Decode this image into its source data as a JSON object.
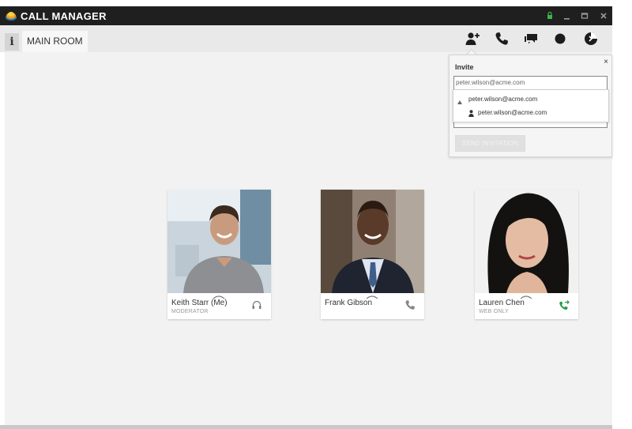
{
  "window": {
    "title": "CALL MANAGER",
    "controls": [
      "lock",
      "minimize",
      "maximize",
      "close"
    ]
  },
  "toolbar": {
    "info_label": "i",
    "room_tab": "MAIN ROOM",
    "actions": [
      "add-user-icon",
      "phone-icon",
      "chat-icon",
      "record-icon",
      "share-icon"
    ]
  },
  "invite": {
    "title": "Invite",
    "close_label": "×",
    "input_value": "peter.wilson@acme.com",
    "suggestions": {
      "group_label": "peter.wilson@acme.com",
      "item_label": "peter.wilson@acme.com"
    },
    "send_label": "SEND INVITATION"
  },
  "participants": [
    {
      "name": "Keith Starr (Me)",
      "role": "MODERATOR",
      "status_icon": "headset-icon"
    },
    {
      "name": "Frank Gibson",
      "role": "",
      "status_icon": "phone-icon"
    },
    {
      "name": "Lauren Chen",
      "role": "WEB ONLY",
      "status_icon": "call-forward-icon"
    }
  ],
  "colors": {
    "titlebar": "#1f1f1f",
    "toolbar": "#e9e9e9",
    "stage": "#f2f2f2",
    "lock_green": "#3cb44b",
    "call_green": "#2a9d4b"
  }
}
